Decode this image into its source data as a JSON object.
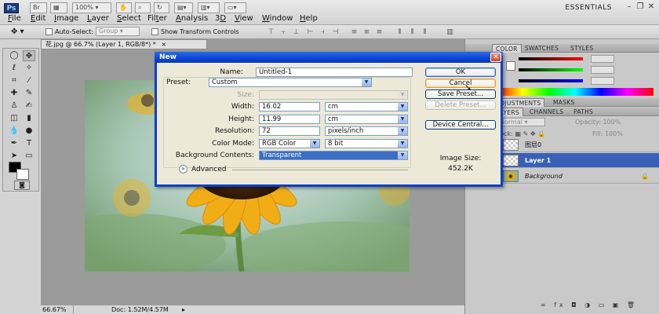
{
  "menubar": {
    "logo": "Ps",
    "zoom": "100%",
    "workspace": "ESSENTIALS",
    "items": [
      "File",
      "Edit",
      "Image",
      "Layer",
      "Select",
      "Filter",
      "Analysis",
      "3D",
      "View",
      "Window",
      "Help"
    ],
    "mnemonics": [
      "F",
      "E",
      "I",
      "L",
      "S",
      "t",
      "A",
      "D",
      "V",
      "W",
      "H"
    ],
    "rests": [
      "ile",
      "dit",
      "mage",
      "ayer",
      "elect",
      "er",
      "nalysis",
      "",
      "iew",
      "indow",
      "elp"
    ],
    "prefixes": [
      "",
      "",
      "",
      "",
      "",
      "Fil",
      "",
      "3",
      "",
      "",
      ""
    ]
  },
  "options": {
    "auto_select_label": "Auto-Select:",
    "auto_select_value": "Group",
    "transform_label": "Show Transform Controls"
  },
  "document": {
    "tab_title": "花.jpg @ 66.7% (Layer 1, RGB/8*) *",
    "close_symbol": "×",
    "status_zoom": "66.67%",
    "status_doc": "Doc: 1.52M/4.57M"
  },
  "panels": {
    "color_tabs": [
      "COLOR",
      "SWATCHES",
      "STYLES"
    ],
    "adjust_tabs": [
      "ADJUSTMENTS",
      "MASKS"
    ],
    "layer_tabs": [
      "LAYERS",
      "CHANNELS",
      "PATHS"
    ],
    "blend_mode": "Normal",
    "opacity_label": "Opacity:",
    "opacity_value": "100%",
    "fill_label": "Fill:",
    "fill_value": "100%",
    "layers": [
      {
        "name": "图层0",
        "selected": false
      },
      {
        "name": "Layer 1",
        "selected": true
      },
      {
        "name": "Background",
        "selected": false
      }
    ]
  },
  "dialog": {
    "title": "New",
    "name_label": "Name:",
    "name_value": "Untitled-1",
    "preset_label": "Preset:",
    "preset_value": "Custom",
    "size_label": "Size:",
    "width_label": "Width:",
    "width_value": "16.02",
    "width_unit": "cm",
    "height_label": "Height:",
    "height_value": "11.99",
    "height_unit": "cm",
    "resolution_label": "Resolution:",
    "resolution_value": "72",
    "resolution_unit": "pixels/inch",
    "color_mode_label": "Color Mode:",
    "color_mode_value": "RGB Color",
    "bit_depth": "8 bit",
    "bg_contents_label": "Background Contents:",
    "bg_contents_value": "Transparent",
    "advanced_label": "Advanced",
    "ok_label": "OK",
    "cancel_label": "Cancel",
    "save_preset_label": "Save Preset...",
    "delete_preset_label": "Delete Preset...",
    "device_central_label": "Device Central...",
    "image_size_label": "Image Size:",
    "image_size_value": "452.2K"
  },
  "colors": {
    "accent": "#0a46d6",
    "selected_layer": "#3860b8",
    "highlight_combo": "#3a6ec6"
  }
}
